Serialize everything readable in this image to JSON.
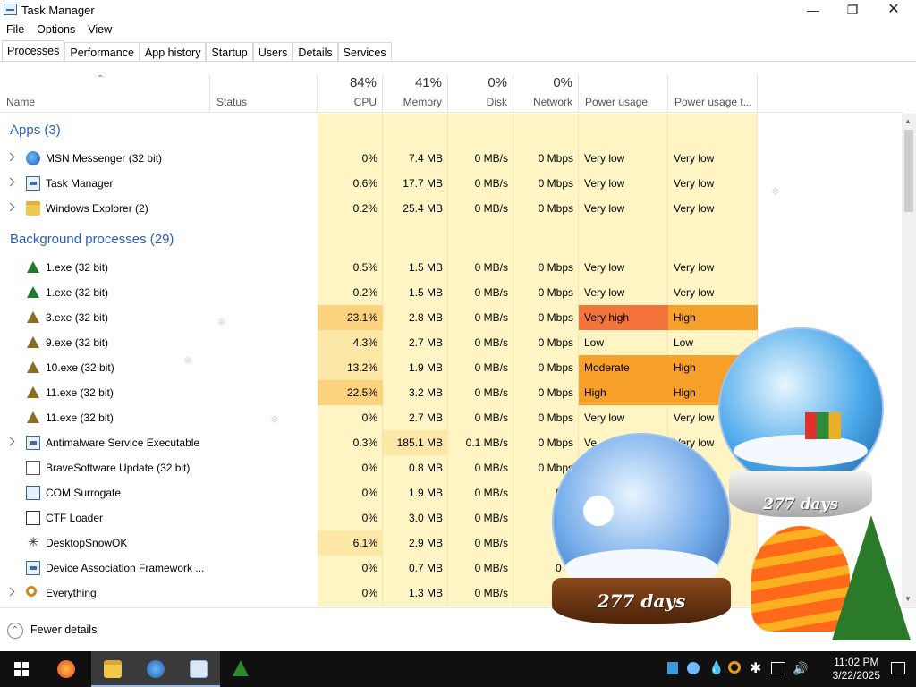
{
  "window": {
    "title": "Task Manager"
  },
  "menu": [
    "File",
    "Options",
    "View"
  ],
  "tabs": [
    "Processes",
    "Performance",
    "App history",
    "Startup",
    "Users",
    "Details",
    "Services"
  ],
  "columns": {
    "name": "Name",
    "status": "Status",
    "cpu": {
      "pct": "84%",
      "label": "CPU"
    },
    "memory": {
      "pct": "41%",
      "label": "Memory"
    },
    "disk": {
      "pct": "0%",
      "label": "Disk"
    },
    "network": {
      "pct": "0%",
      "label": "Network"
    },
    "power": "Power usage",
    "power_trend": "Power usage t..."
  },
  "groups": {
    "apps": "Apps (3)",
    "background": "Background processes (29)"
  },
  "apps": [
    {
      "name": "MSN Messenger (32 bit)",
      "cpu": "0%",
      "mem": "7.4 MB",
      "disk": "0 MB/s",
      "net": "0 Mbps",
      "power": "Very low",
      "trend": "Very low",
      "icon": "msn-icon"
    },
    {
      "name": "Task Manager",
      "cpu": "0.6%",
      "mem": "17.7 MB",
      "disk": "0 MB/s",
      "net": "0 Mbps",
      "power": "Very low",
      "trend": "Very low",
      "icon": "task-manager-icon"
    },
    {
      "name": "Windows Explorer (2)",
      "cpu": "0.2%",
      "mem": "25.4 MB",
      "disk": "0 MB/s",
      "net": "0 Mbps",
      "power": "Very low",
      "trend": "Very low",
      "icon": "folder-icon"
    }
  ],
  "background": [
    {
      "name": "1.exe (32 bit)",
      "cpu": "0.5%",
      "mem": "1.5 MB",
      "disk": "0 MB/s",
      "net": "0 Mbps",
      "power": "Very low",
      "trend": "Very low"
    },
    {
      "name": "1.exe (32 bit)",
      "cpu": "0.2%",
      "mem": "1.5 MB",
      "disk": "0 MB/s",
      "net": "0 Mbps",
      "power": "Very low",
      "trend": "Very low"
    },
    {
      "name": "3.exe (32 bit)",
      "cpu": "23.1%",
      "mem": "2.8 MB",
      "disk": "0 MB/s",
      "net": "0 Mbps",
      "power": "Very high",
      "trend": "High"
    },
    {
      "name": "9.exe (32 bit)",
      "cpu": "4.3%",
      "mem": "2.7 MB",
      "disk": "0 MB/s",
      "net": "0 Mbps",
      "power": "Low",
      "trend": "Low"
    },
    {
      "name": "10.exe (32 bit)",
      "cpu": "13.2%",
      "mem": "1.9 MB",
      "disk": "0 MB/s",
      "net": "0 Mbps",
      "power": "Moderate",
      "trend": "High"
    },
    {
      "name": "11.exe (32 bit)",
      "cpu": "22.5%",
      "mem": "3.2 MB",
      "disk": "0 MB/s",
      "net": "0 Mbps",
      "power": "High",
      "trend": "High"
    },
    {
      "name": "11.exe (32 bit)",
      "cpu": "0%",
      "mem": "2.7 MB",
      "disk": "0 MB/s",
      "net": "0 Mbps",
      "power": "Very low",
      "trend": "Very low"
    },
    {
      "name": "Antimalware Service Executable",
      "cpu": "0.3%",
      "mem": "185.1 MB",
      "disk": "0.1 MB/s",
      "net": "0 Mbps",
      "power": "Ve",
      "trend": "Very low"
    },
    {
      "name": "BraveSoftware Update (32 bit)",
      "cpu": "0%",
      "mem": "0.8 MB",
      "disk": "0 MB/s",
      "net": "0 Mbps",
      "power": "",
      "trend": ""
    },
    {
      "name": "COM Surrogate",
      "cpu": "0%",
      "mem": "1.9 MB",
      "disk": "0 MB/s",
      "net": "0 M",
      "power": "",
      "trend": ""
    },
    {
      "name": "CTF Loader",
      "cpu": "0%",
      "mem": "3.0 MB",
      "disk": "0 MB/s",
      "net": "0 M",
      "power": "",
      "trend": ""
    },
    {
      "name": "DesktopSnowOK",
      "cpu": "6.1%",
      "mem": "2.9 MB",
      "disk": "0 MB/s",
      "net": "0 M",
      "power": "",
      "trend": ""
    },
    {
      "name": "Device Association Framework ...",
      "cpu": "0%",
      "mem": "0.7 MB",
      "disk": "0 MB/s",
      "net": "0 M",
      "power": "",
      "trend": ""
    },
    {
      "name": "Everything",
      "cpu": "0%",
      "mem": "1.3 MB",
      "disk": "0 MB/s",
      "net": "0 M",
      "power": "",
      "trend": ""
    }
  ],
  "footer": {
    "fewer_details": "Fewer details"
  },
  "overlay": {
    "globe_text_1": "277 days",
    "globe_text_2": "277 days"
  },
  "taskbar": {
    "time": "11:02 PM",
    "date": "3/22/2025"
  },
  "colors": {
    "very_high": "#f4743b",
    "high": "#f7a12a",
    "cpu_tint": "#fff4c4",
    "group_blue": "#2a5fb8"
  }
}
